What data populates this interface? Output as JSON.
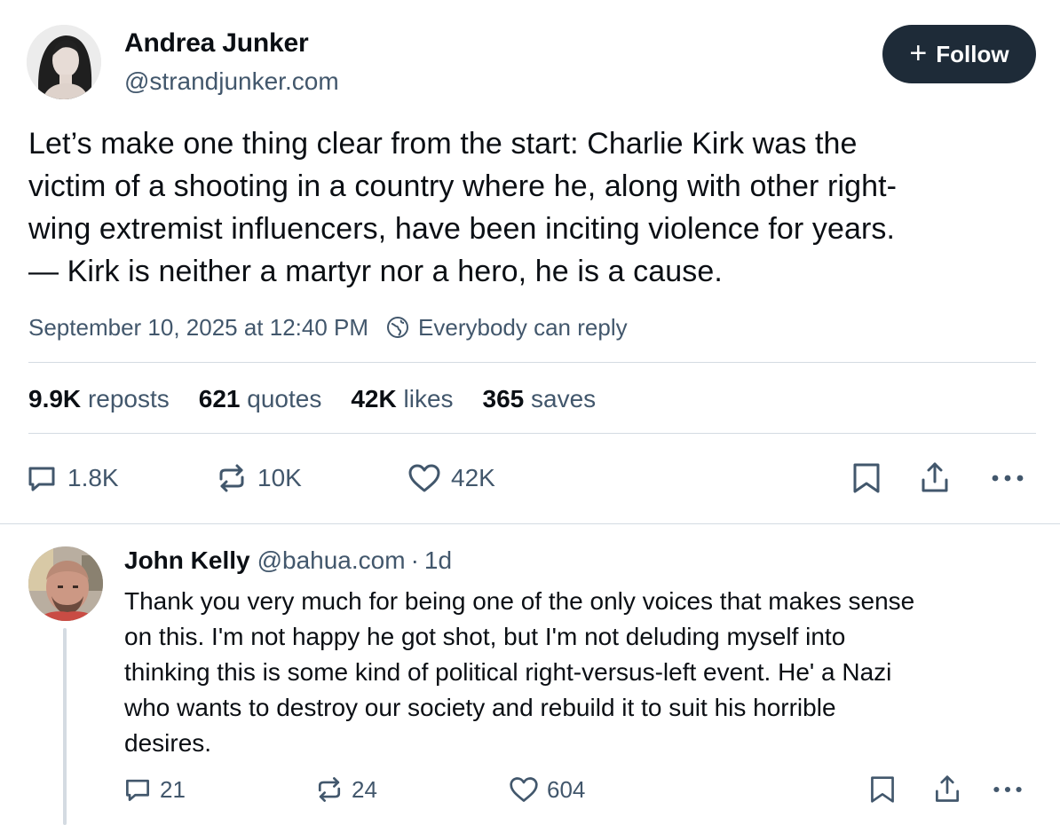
{
  "post": {
    "author": {
      "name": "Andrea Junker",
      "handle": "@strandjunker.com"
    },
    "follow_label": "Follow",
    "text_lines": [
      "Let’s make one thing clear from the start: Charlie Kirk was the",
      "victim of a shooting in a country where he, along with other right-",
      "wing extremist influencers, have been inciting violence for years.",
      "— Kirk is neither a martyr nor a hero, he is a cause."
    ],
    "timestamp": "September 10, 2025 at 12:40 PM",
    "reply_setting": "Everybody can reply",
    "stats": [
      {
        "count": "9.9K",
        "label": "reposts"
      },
      {
        "count": "621",
        "label": "quotes"
      },
      {
        "count": "42K",
        "label": "likes"
      },
      {
        "count": "365",
        "label": "saves"
      }
    ],
    "actions": {
      "replies": "1.8K",
      "reposts": "10K",
      "likes": "42K"
    }
  },
  "reply": {
    "author": {
      "name": "John Kelly",
      "handle": "@bahua.com",
      "separator": "·",
      "time": "1d"
    },
    "text_lines": [
      "Thank you very much for being one of the only voices that makes sense",
      "on this. I'm not happy he got shot, but I'm not deluding myself into",
      "thinking this is some kind of political right-versus-left event. He' a Nazi",
      "who wants to destroy our society and rebuild it to suit his horrible",
      "desires."
    ],
    "actions": {
      "replies": "21",
      "reposts": "24",
      "likes": "604"
    }
  },
  "icons": {
    "reply": "speech-bubble-icon",
    "repost": "repost-arrows-icon",
    "like": "heart-icon",
    "bookmark": "bookmark-icon",
    "share": "share-icon",
    "more": "ellipsis-icon",
    "reply_setting": "globe-icon"
  },
  "colors": {
    "text": "#0b0f14",
    "muted": "#42576c",
    "follow_bg": "#1e2b38",
    "divider": "#d4dbe2"
  }
}
